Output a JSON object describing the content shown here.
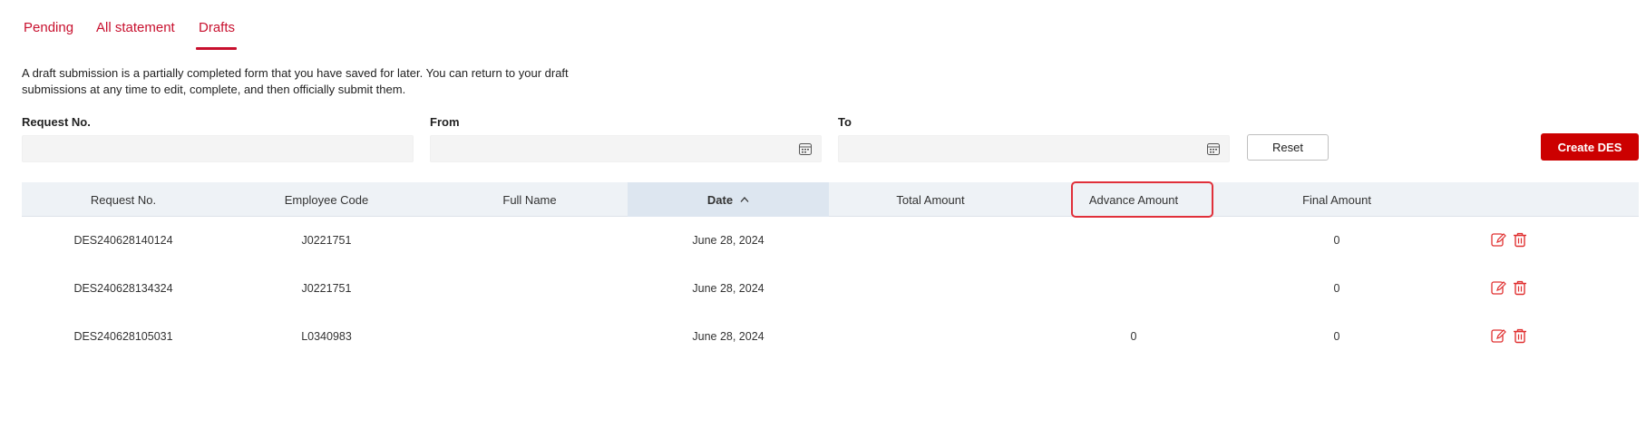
{
  "tabs": [
    {
      "label": "Pending",
      "active": false
    },
    {
      "label": "All statement",
      "active": false
    },
    {
      "label": "Drafts",
      "active": true
    }
  ],
  "description": "A draft submission is a partially completed form that you have saved for later. You can return to your draft submissions at any time to edit, complete, and then officially submit them.",
  "filters": {
    "request_no": {
      "label": "Request No.",
      "value": "",
      "placeholder": ""
    },
    "from": {
      "label": "From",
      "value": "",
      "placeholder": ""
    },
    "to": {
      "label": "To",
      "value": "",
      "placeholder": ""
    }
  },
  "buttons": {
    "reset": "Reset",
    "create": "Create DES"
  },
  "table": {
    "headers": {
      "request_no": "Request No.",
      "employee_code": "Employee Code",
      "full_name": "Full Name",
      "date": "Date",
      "total_amount": "Total Amount",
      "advance_amount": "Advance Amount",
      "final_amount": "Final Amount"
    },
    "sort": {
      "column": "date",
      "direction": "ascending"
    },
    "rows": [
      {
        "request_no": "DES240628140124",
        "employee_code": "J0221751",
        "full_name": "",
        "date": "June 28, 2024",
        "total_amount": "",
        "advance_amount": "",
        "final_amount": "0"
      },
      {
        "request_no": "DES240628134324",
        "employee_code": "J0221751",
        "full_name": "",
        "date": "June 28, 2024",
        "total_amount": "",
        "advance_amount": "",
        "final_amount": "0"
      },
      {
        "request_no": "DES240628105031",
        "employee_code": "L0340983",
        "full_name": "",
        "date": "June 28, 2024",
        "total_amount": "",
        "advance_amount": "0",
        "final_amount": "0"
      }
    ]
  },
  "icons": {
    "calendar": "calendar-icon",
    "sort": "chevron-up-icon",
    "edit": "edit-icon",
    "delete": "trash-icon"
  },
  "colors": {
    "accent": "#c8102e",
    "primary_button": "#cc0000",
    "header_bg": "#eef2f6",
    "sorted_header_bg": "#dde6f0",
    "highlight": "#e0303a"
  }
}
